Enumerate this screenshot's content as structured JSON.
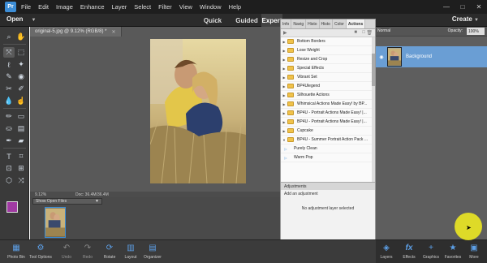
{
  "menubar": {
    "logo": "Pr",
    "items": [
      "File",
      "Edit",
      "Image",
      "Enhance",
      "Layer",
      "Select",
      "Filter",
      "View",
      "Window",
      "Help"
    ],
    "window_controls": [
      "—",
      "□",
      "✕"
    ]
  },
  "modebar": {
    "open_label": "Open",
    "modes": [
      "Quick",
      "Guided",
      "Expert"
    ],
    "active_mode": "Expert",
    "create_label": "Create"
  },
  "document": {
    "tab_title": "original-5.jpg @ 9.12% (RGB/8) *",
    "zoom": "9.12%",
    "doc_size": "Doc: 36.4M/36.4M"
  },
  "photo_bin": {
    "show_label": "Show Open Files"
  },
  "panels": {
    "tabs": [
      "Info",
      "Navig",
      "Histo",
      "Histo",
      "Color",
      "Actions"
    ],
    "active_tab": "Actions",
    "actions": [
      {
        "label": "Bottom Borders",
        "type": "folder"
      },
      {
        "label": "Lose Weight",
        "type": "folder"
      },
      {
        "label": "Resize and Crop",
        "type": "folder"
      },
      {
        "label": "Special Effects",
        "type": "folder"
      },
      {
        "label": "Vibrant Set",
        "type": "folder"
      },
      {
        "label": "BP4Ulegend",
        "type": "folder"
      },
      {
        "label": "Silhouette Actions",
        "type": "folder"
      },
      {
        "label": "Whimsical Actions Made Easy! by BP...",
        "type": "folder"
      },
      {
        "label": "BP4U - Portrait Actions Made Easy! |...",
        "type": "folder"
      },
      {
        "label": "BP4U - Portrait Actions Made Easy! |...",
        "type": "folder"
      },
      {
        "label": "Cupcake",
        "type": "folder"
      },
      {
        "label": "BP4U - Summer Portrait Action Pack ...",
        "type": "folder"
      },
      {
        "label": "Purely Clean",
        "type": "child"
      },
      {
        "label": "Warm Pop",
        "type": "child"
      }
    ],
    "adjustments_tab": "Adjustments",
    "add_adjustment": "Add an adjustment",
    "no_adjustment": "No adjustment layer selected"
  },
  "layers": {
    "blend_mode": "Normal",
    "opacity_label": "Opacity:",
    "opacity_value": "100%",
    "layer_name": "Background"
  },
  "bottombar": {
    "left": [
      {
        "label": "Photo Bin",
        "icon": "photo-bin-icon",
        "glyph": "▦"
      },
      {
        "label": "Tool Options",
        "icon": "tool-options-icon",
        "glyph": "⚙"
      },
      {
        "label": "Undo",
        "icon": "undo-icon",
        "glyph": "↶"
      },
      {
        "label": "Redo",
        "icon": "redo-icon",
        "glyph": "↷"
      },
      {
        "label": "Rotate",
        "icon": "rotate-icon",
        "glyph": "⟳"
      },
      {
        "label": "Layout",
        "icon": "layout-icon",
        "glyph": "▥"
      },
      {
        "label": "Organizer",
        "icon": "organizer-icon",
        "glyph": "▤"
      }
    ],
    "right": [
      {
        "label": "Layers",
        "icon": "layers-icon",
        "glyph": "◈"
      },
      {
        "label": "Effects",
        "icon": "effects-icon",
        "glyph": "fx"
      },
      {
        "label": "Graphics",
        "icon": "graphics-icon",
        "glyph": "+"
      },
      {
        "label": "Favorites",
        "icon": "favorites-icon",
        "glyph": "★"
      },
      {
        "label": "More",
        "icon": "more-icon",
        "glyph": "▣"
      }
    ]
  },
  "colors": {
    "foreground": "#a03aa2",
    "accent": "#3c8dd6",
    "layer_selected": "#6a9ed4"
  }
}
